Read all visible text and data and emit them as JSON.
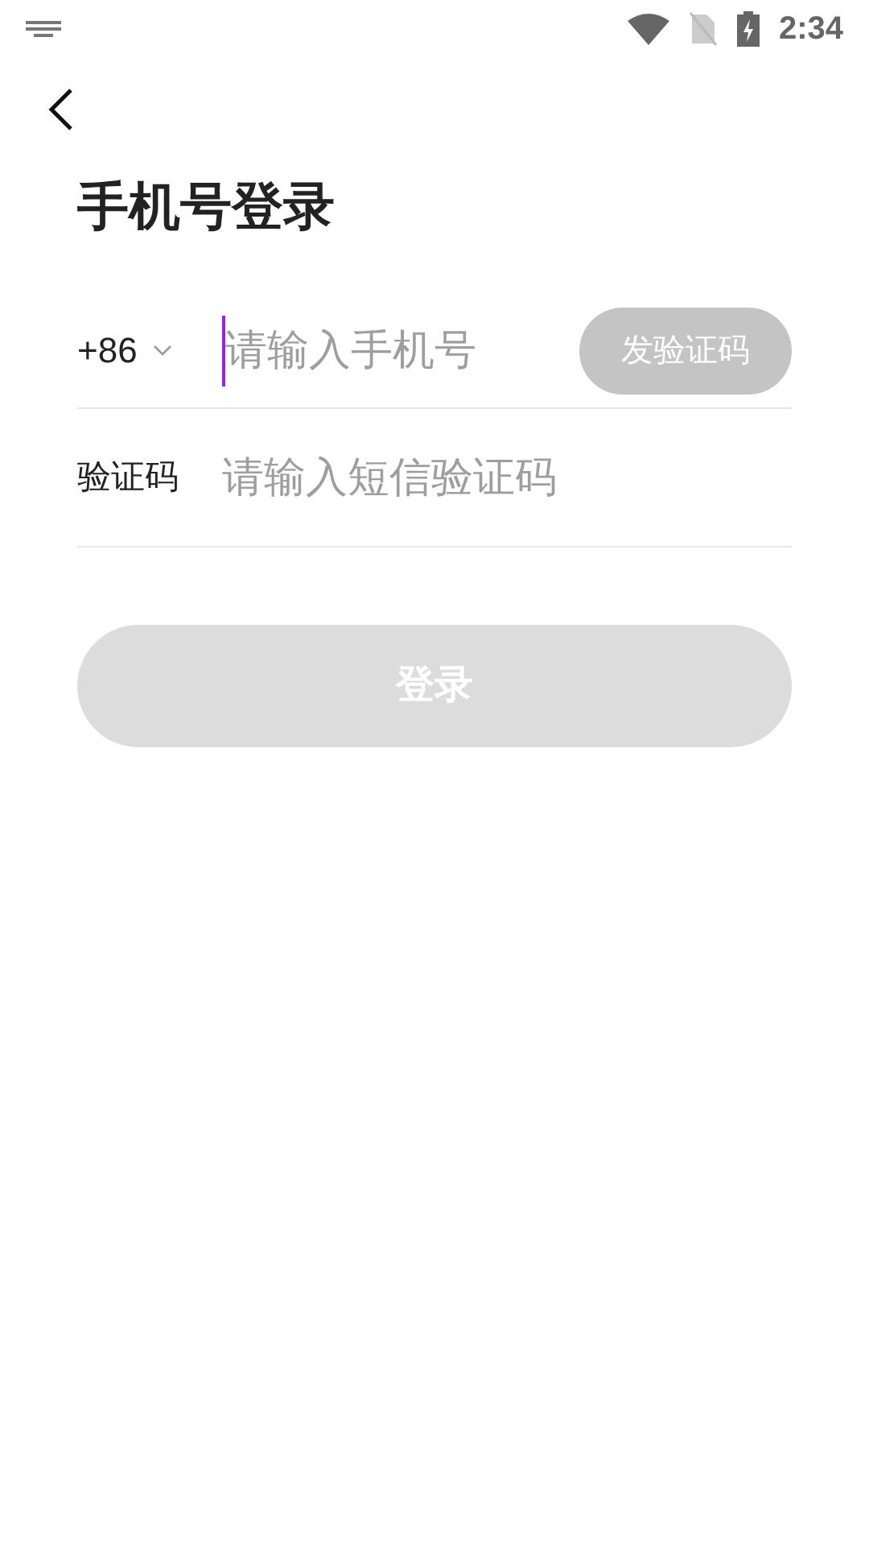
{
  "status_bar": {
    "time": "2:34"
  },
  "title": "手机号登录",
  "phone_row": {
    "country_code": "+86",
    "placeholder": "请输入手机号",
    "focused": true,
    "send_code_button": {
      "label": "发验证码",
      "disabled": true
    }
  },
  "code_row": {
    "label": "验证码",
    "placeholder": "请输入短信验证码"
  },
  "login_button": {
    "label": "登录",
    "disabled": true
  }
}
